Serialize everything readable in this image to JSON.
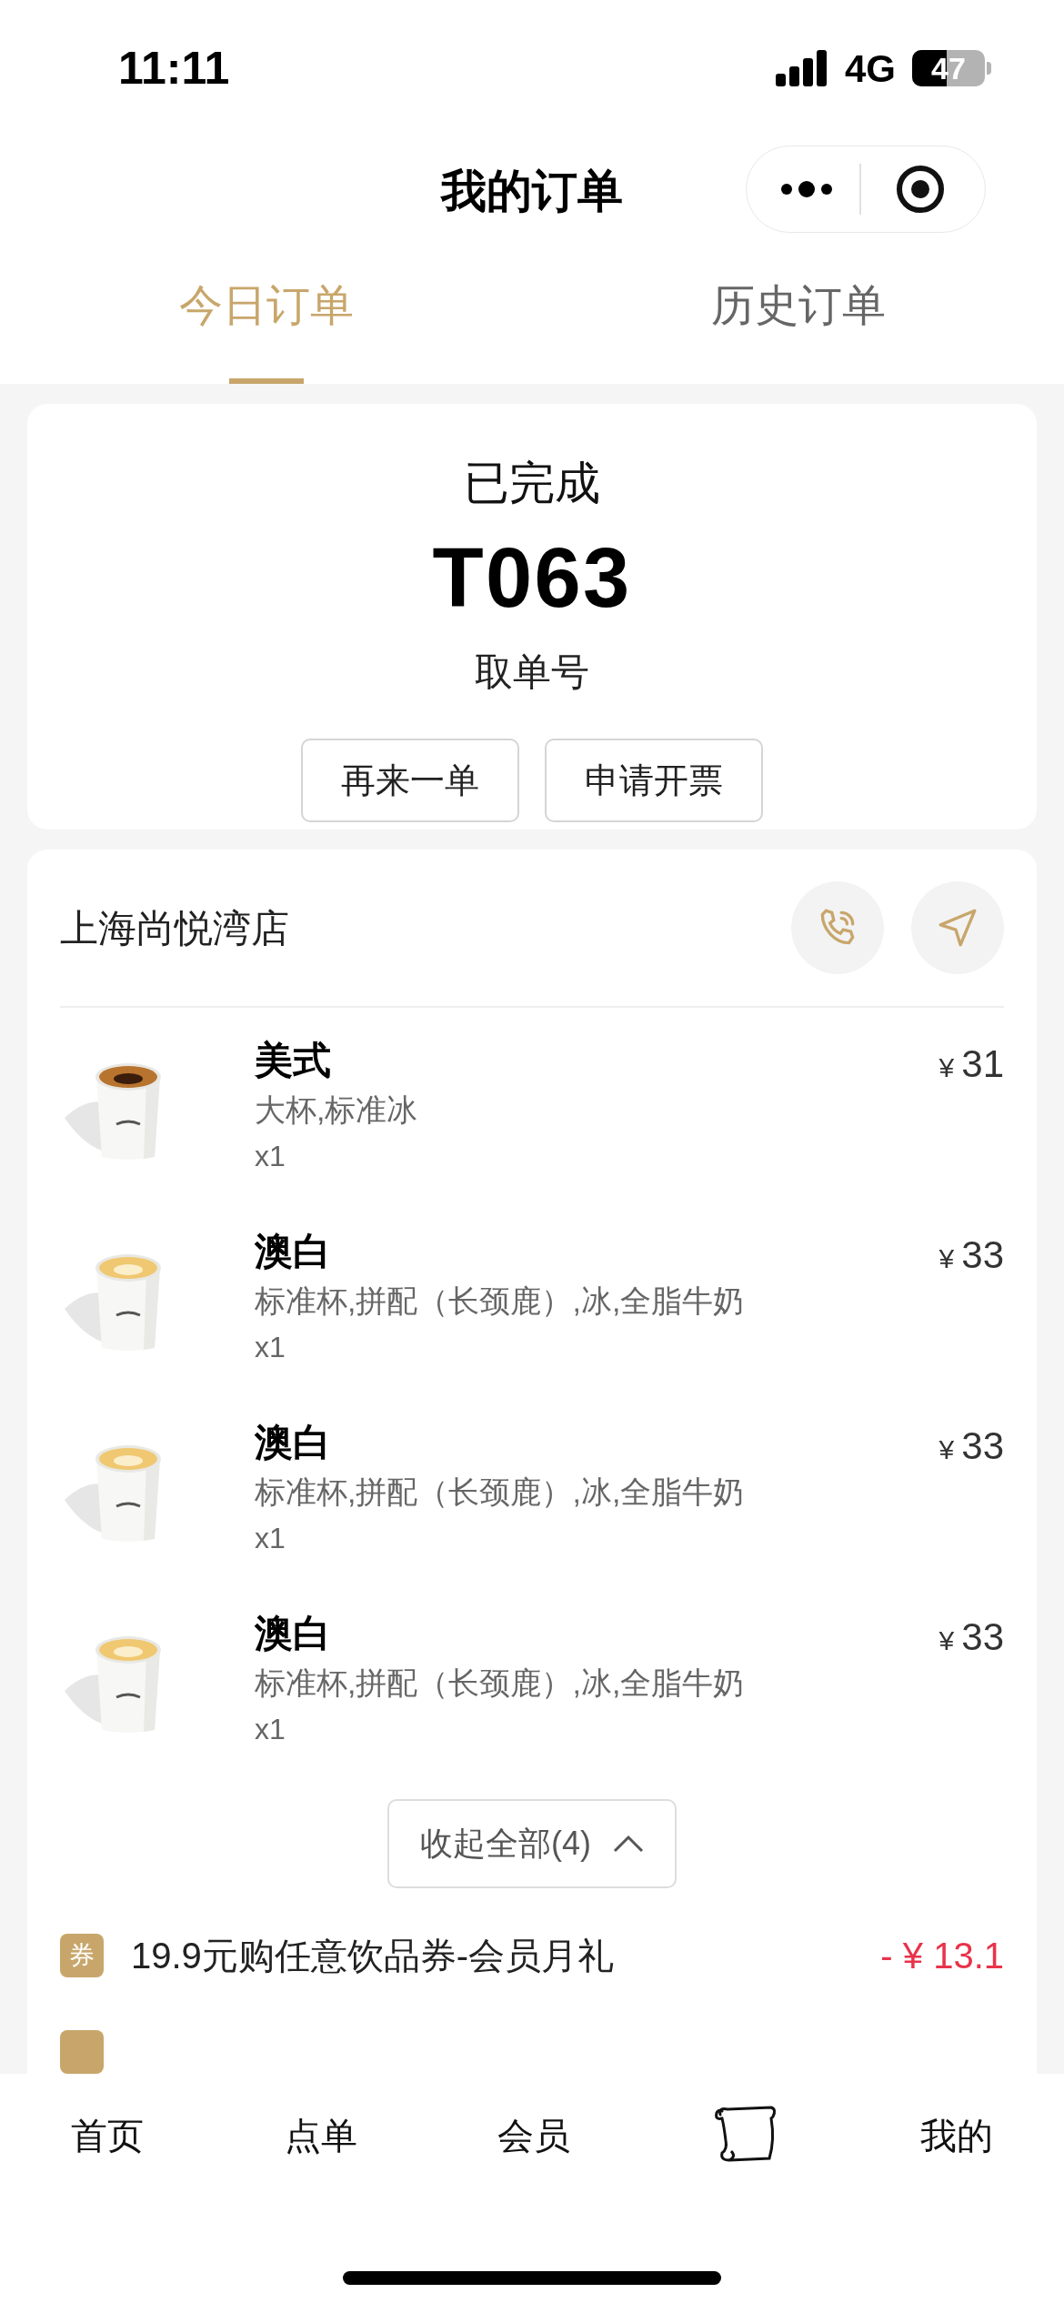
{
  "status_bar": {
    "time": "11:11",
    "network": "4G",
    "battery": "47"
  },
  "nav": {
    "title": "我的订单"
  },
  "tabs": [
    {
      "label": "今日订单",
      "selected": true
    },
    {
      "label": "历史订单",
      "selected": false
    }
  ],
  "order": {
    "status": "已完成",
    "pickup_number": "T063",
    "pickup_label": "取单号",
    "actions": [
      "再来一单",
      "申请开票"
    ]
  },
  "store": {
    "name": "上海尚悦湾店"
  },
  "items": [
    {
      "kind": "americano",
      "name": "美式",
      "options": "大杯,标准冰",
      "quantity": "x1",
      "currency": "¥",
      "amount": "31"
    },
    {
      "kind": "latte",
      "name": "澳白",
      "options": "标准杯,拼配（长颈鹿）,冰,全脂牛奶",
      "quantity": "x1",
      "currency": "¥",
      "amount": "33"
    },
    {
      "kind": "latte",
      "name": "澳白",
      "options": "标准杯,拼配（长颈鹿）,冰,全脂牛奶",
      "quantity": "x1",
      "currency": "¥",
      "amount": "33"
    },
    {
      "kind": "latte",
      "name": "澳白",
      "options": "标准杯,拼配（长颈鹿）,冰,全脂牛奶",
      "quantity": "x1",
      "currency": "¥",
      "amount": "33"
    }
  ],
  "collapse": {
    "label": "收起全部(4)"
  },
  "discounts": [
    {
      "badge": "券",
      "label": "19.9元购任意饮品券-会员月礼",
      "amount": "- ¥ 13.1"
    }
  ],
  "bottom_nav": [
    {
      "kind": "text",
      "label": "首页"
    },
    {
      "kind": "text",
      "label": "点单"
    },
    {
      "kind": "text",
      "label": "会员"
    },
    {
      "kind": "icon"
    },
    {
      "kind": "text",
      "label": "我的"
    }
  ]
}
